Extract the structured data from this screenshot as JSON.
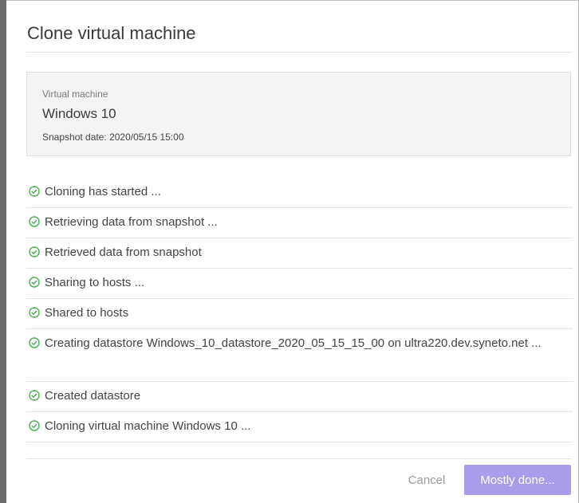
{
  "dialog": {
    "title": "Clone virtual machine"
  },
  "vm": {
    "caption": "Virtual machine",
    "name": "Windows 10",
    "snapshot_date": "Snapshot date: 2020/05/15 15:00"
  },
  "steps": [
    {
      "label": "Cloning has started ...",
      "icon": "check-circle-icon"
    },
    {
      "label": "Retrieving data from snapshot ...",
      "icon": "check-circle-icon"
    },
    {
      "label": "Retrieved data from snapshot",
      "icon": "check-circle-icon"
    },
    {
      "label": "Sharing to hosts ...",
      "icon": "check-circle-icon"
    },
    {
      "label": "Shared to hosts",
      "icon": "check-circle-icon"
    },
    {
      "label": "Creating datastore Windows_10_datastore_2020_05_15_15_00 on ultra220.dev.syneto.net ...",
      "icon": "check-circle-icon"
    },
    {
      "label": "Created datastore",
      "icon": "check-circle-icon"
    },
    {
      "label": "Cloning virtual machine Windows 10 ...",
      "icon": "check-circle-icon"
    }
  ],
  "footer": {
    "cancel_label": "Cancel",
    "primary_label": "Mostly done..."
  },
  "colors": {
    "check": "#4caf50",
    "primary_button": "#a99cea"
  }
}
